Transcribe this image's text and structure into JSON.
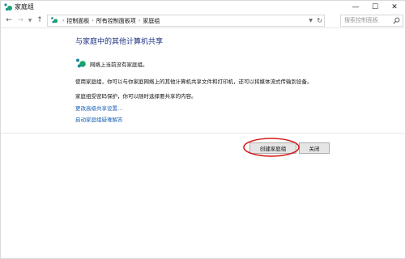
{
  "window": {
    "title": "家庭组",
    "minimize_icon": "minimize-icon",
    "maximize_icon": "maximize-icon",
    "close_icon": "close-icon"
  },
  "nav": {
    "breadcrumbs": [
      "控制面板",
      "所有控制面板项",
      "家庭组"
    ],
    "search_placeholder": "搜索控制面板"
  },
  "content": {
    "heading": "与家庭中的其他计算机共享",
    "status": "网络上当前没有家庭组。",
    "paragraph1": "使用家庭组，你可以与你家庭网络上的其他计算机共享文件和打印机，还可以将媒体流式传输到设备。",
    "paragraph2": "家庭组受密码保护，你可以随时选择要共享的内容。",
    "link_advanced": "更改高级共享设置...",
    "link_troubleshoot": "启动家庭组疑难解答"
  },
  "buttons": {
    "create": "创建家庭组",
    "close": "关闭"
  },
  "colors": {
    "heading": "#1e3287",
    "link": "#1a5fb4",
    "highlight_ellipse": "#d21e1e",
    "homegroup_green": "#1aa36b",
    "homegroup_teal": "#158c9c"
  }
}
